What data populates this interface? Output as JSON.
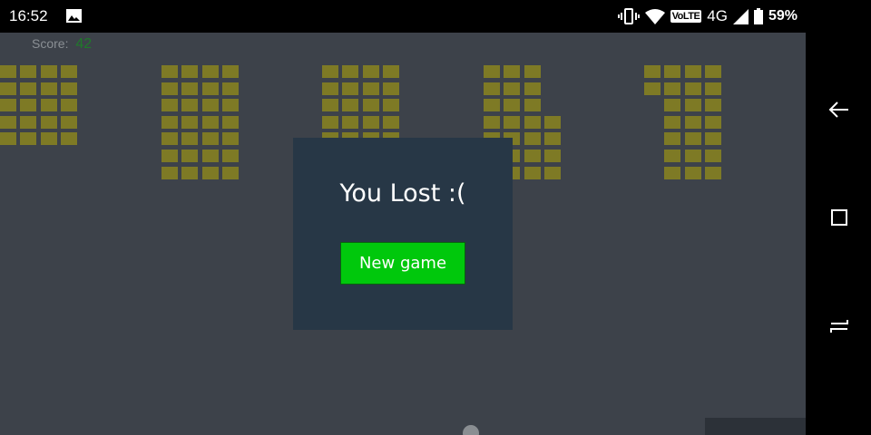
{
  "status_bar": {
    "time": "16:52",
    "network_badge": "VoLTE",
    "network_type": "4G",
    "battery": "59%"
  },
  "game": {
    "score_label": "Score:",
    "score_value": "42",
    "brick_color": "#7e7a25",
    "background_color": "#3d424a"
  },
  "modal": {
    "title": "You Lost :(",
    "new_game_label": "New game",
    "button_color": "#00c80c"
  },
  "nav": {
    "back": "back-icon",
    "home": "home-icon",
    "recents": "recents-icon"
  }
}
